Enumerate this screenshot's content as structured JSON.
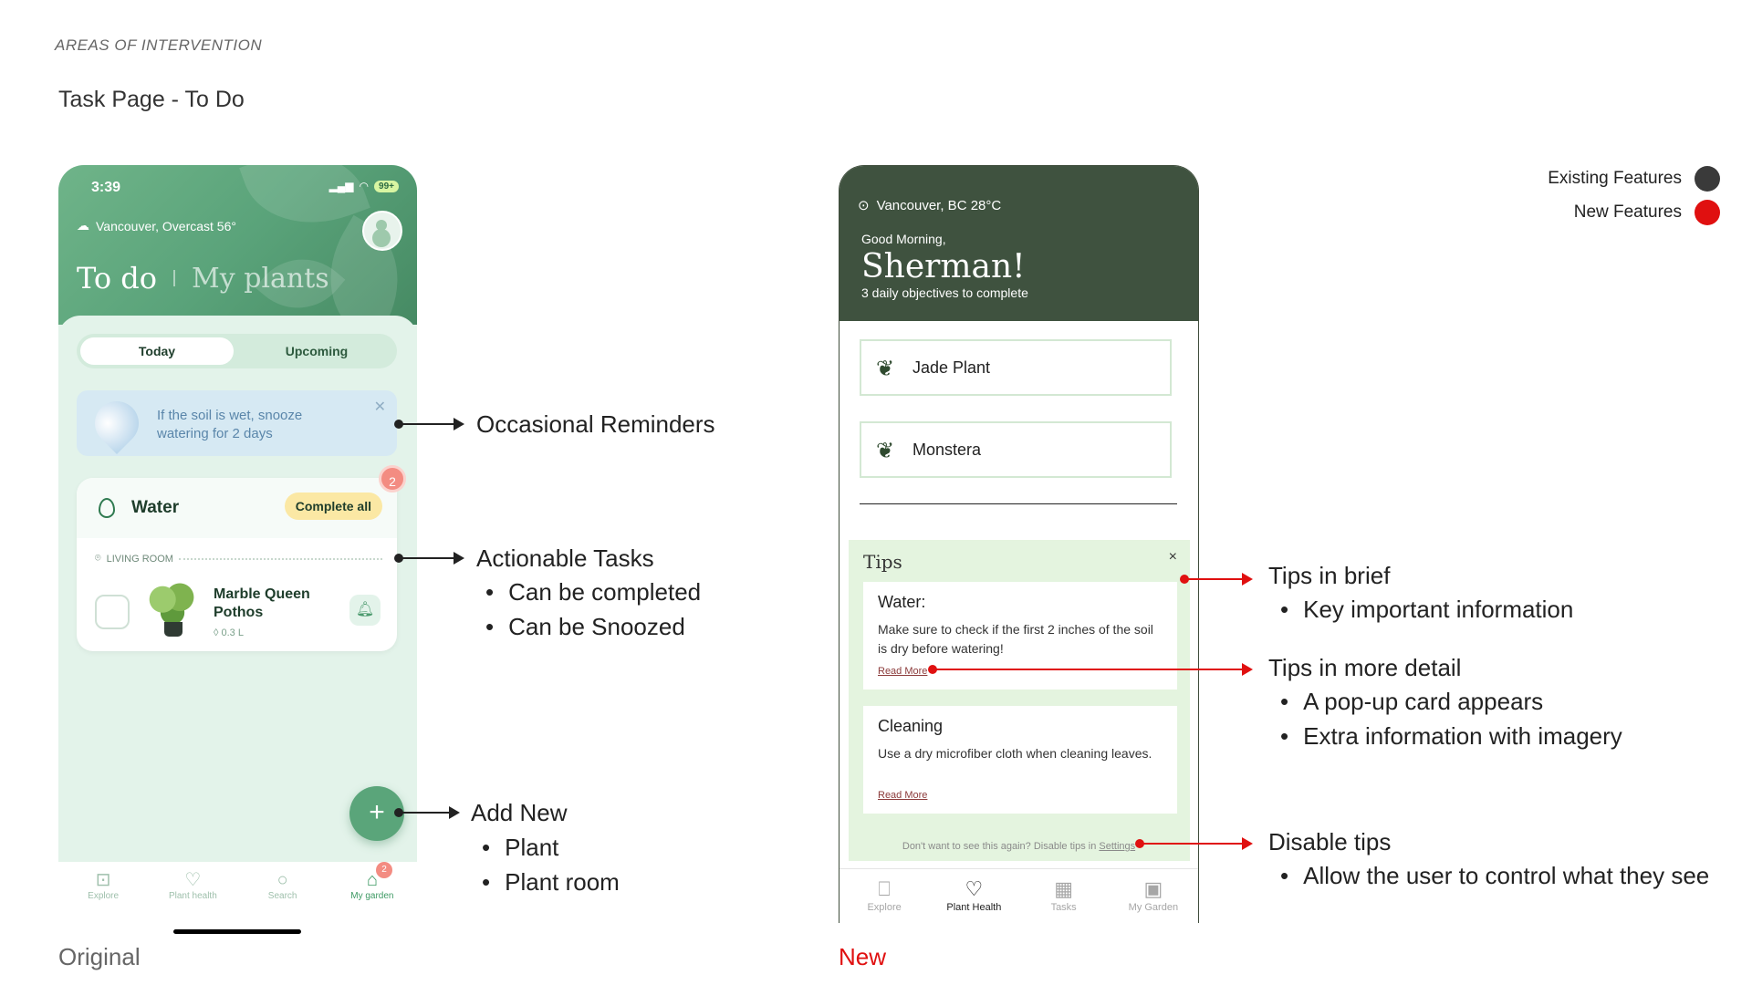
{
  "section_tag": "AREAS OF INTERVENTION",
  "page_title": "Task Page - To Do",
  "legend": {
    "existing_label": "Existing Features",
    "existing_color": "#3a3a3a",
    "new_label": "New Features",
    "new_color": "#e01010"
  },
  "original": {
    "caption": "Original",
    "status_time": "3:39",
    "battery": "99+",
    "location": "Vancouver, Overcast 56°",
    "header_tabs": {
      "active": "To do",
      "inactive": "My plants"
    },
    "segments": {
      "today": "Today",
      "upcoming": "Upcoming"
    },
    "reminder_text": "If the soil is wet, snooze watering for 2 days",
    "task_group": {
      "title": "Water",
      "action": "Complete all",
      "count": "2",
      "room": "LIVING ROOM",
      "plant_name": "Marble Queen Pothos",
      "amount": "0.3 L"
    },
    "fab_symbol": "+",
    "nav": [
      {
        "label": "Explore",
        "icon": "explore-icon"
      },
      {
        "label": "Plant health",
        "icon": "heart-pulse-icon"
      },
      {
        "label": "Search",
        "icon": "search-icon"
      },
      {
        "label": "My garden",
        "icon": "garden-icon"
      }
    ],
    "nav_badge": "2"
  },
  "new": {
    "caption": "New",
    "location": "Vancouver, BC  28°C",
    "greeting": "Good Morning,",
    "name": "Sherman!",
    "objectives": "3 daily objectives to complete",
    "plants": [
      "Jade Plant",
      "Monstera"
    ],
    "tips": {
      "title": "Tips",
      "close": "×",
      "cards": [
        {
          "title": "Water:",
          "body": "Make sure to check if the first 2 inches of the soil is dry before watering!",
          "link": "Read More"
        },
        {
          "title": "Cleaning",
          "body": "Use a dry microfiber cloth when cleaning leaves.",
          "link": "Read More"
        }
      ]
    },
    "disable_text": "Don't want to see this again? Disable tips in ",
    "disable_link": "Settings",
    "nav": [
      {
        "label": "Explore",
        "icon": "book-icon"
      },
      {
        "label": "Plant Health",
        "icon": "heart-pulse-icon"
      },
      {
        "label": "Tasks",
        "icon": "calendar-check-icon"
      },
      {
        "label": "My Garden",
        "icon": "garden-icon"
      }
    ]
  },
  "annotations": {
    "reminders": {
      "title": "Occasional Reminders"
    },
    "tasks": {
      "title": "Actionable Tasks",
      "bullets": [
        "Can be completed",
        "Can be Snoozed"
      ]
    },
    "add_new": {
      "title": "Add New",
      "bullets": [
        "Plant",
        "Plant room"
      ]
    },
    "tips_brief": {
      "title": "Tips in brief",
      "bullets": [
        "Key important information"
      ]
    },
    "tips_detail": {
      "title": "Tips in more detail",
      "bullets": [
        "A pop-up card appears",
        "Extra information with imagery"
      ]
    },
    "disable_tips": {
      "title": "Disable tips",
      "bullets": [
        "Allow the user to control what they see"
      ]
    }
  }
}
